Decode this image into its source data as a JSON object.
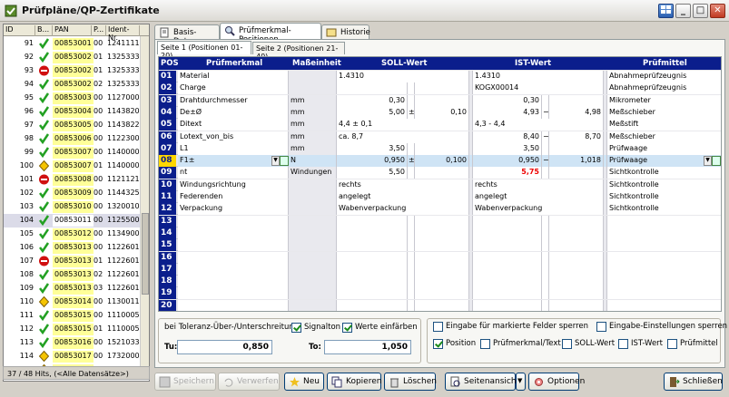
{
  "window": {
    "title": "Prüfpläne/QP-Zertifikate"
  },
  "left": {
    "columns": [
      "ID",
      "B...",
      "PAN",
      "P...",
      "Ident-Nr."
    ],
    "rows": [
      {
        "id": "91",
        "status": "ok",
        "pan": "00853001",
        "p": "00",
        "ident": "1241111"
      },
      {
        "id": "92",
        "status": "ok",
        "pan": "00853002",
        "p": "01",
        "ident": "1325333"
      },
      {
        "id": "93",
        "status": "stop",
        "pan": "00853002",
        "p": "01",
        "ident": "1325333"
      },
      {
        "id": "94",
        "status": "ok",
        "pan": "00853002",
        "p": "02",
        "ident": "1325333"
      },
      {
        "id": "95",
        "status": "ok",
        "pan": "00853003",
        "p": "00",
        "ident": "1127000"
      },
      {
        "id": "96",
        "status": "ok",
        "pan": "00853004",
        "p": "00",
        "ident": "1143820"
      },
      {
        "id": "97",
        "status": "ok",
        "pan": "00853005",
        "p": "00",
        "ident": "1143822"
      },
      {
        "id": "98",
        "status": "ok",
        "pan": "00853006",
        "p": "00",
        "ident": "1122300"
      },
      {
        "id": "99",
        "status": "ok",
        "pan": "00853007",
        "p": "00",
        "ident": "1140000"
      },
      {
        "id": "100",
        "status": "warn",
        "pan": "00853007",
        "p": "01",
        "ident": "1140000"
      },
      {
        "id": "101",
        "status": "stop",
        "pan": "00853008",
        "p": "00",
        "ident": "1121121"
      },
      {
        "id": "102",
        "status": "ok",
        "pan": "00853009",
        "p": "00",
        "ident": "1144325"
      },
      {
        "id": "103",
        "status": "ok",
        "pan": "00853010",
        "p": "00",
        "ident": "1320010"
      },
      {
        "id": "104",
        "status": "ok",
        "pan": "00853011",
        "p": "00",
        "ident": "1125500"
      },
      {
        "id": "105",
        "status": "ok",
        "pan": "00853012",
        "p": "00",
        "ident": "1134900"
      },
      {
        "id": "106",
        "status": "ok",
        "pan": "00853013",
        "p": "00",
        "ident": "1122601"
      },
      {
        "id": "107",
        "status": "stop",
        "pan": "00853013",
        "p": "01",
        "ident": "1122601"
      },
      {
        "id": "108",
        "status": "ok",
        "pan": "00853013",
        "p": "02",
        "ident": "1122601"
      },
      {
        "id": "109",
        "status": "ok",
        "pan": "00853013",
        "p": "03",
        "ident": "1122601"
      },
      {
        "id": "110",
        "status": "warn",
        "pan": "00853014",
        "p": "00",
        "ident": "1130011"
      },
      {
        "id": "111",
        "status": "ok",
        "pan": "00853015",
        "p": "00",
        "ident": "1110005"
      },
      {
        "id": "112",
        "status": "ok",
        "pan": "00853015",
        "p": "01",
        "ident": "1110005"
      },
      {
        "id": "113",
        "status": "ok",
        "pan": "00853016",
        "p": "00",
        "ident": "1521033"
      },
      {
        "id": "114",
        "status": "warn",
        "pan": "00853017",
        "p": "00",
        "ident": "1732000"
      },
      {
        "id": "115",
        "status": "warn",
        "pan": "00853018",
        "p": "00",
        "ident": "1630001"
      }
    ],
    "footer": "37 / 48 Hits, (<Alle Datensätze>)"
  },
  "tabs": [
    "Basis-Daten",
    "Prüfmerkmal-Positionen",
    "Historie"
  ],
  "subtabs": [
    "Seite 1 (Positionen 01-20)",
    "Seite 2 (Positionen 21-40)"
  ],
  "grid": {
    "headers": {
      "pos": "POS",
      "merkmal": "Prüfmerkmal",
      "einheit": "Maßeinheit",
      "soll": "SOLL-Wert",
      "ist": "IST-Wert",
      "mittel": "Prüfmittel"
    },
    "rows": [
      {
        "pos": "01",
        "merkmal": "Material",
        "einheit": "",
        "soll": "1.4310",
        "s1": "",
        "s2": "",
        "ist": "1.4310",
        "i1": "",
        "i2": "",
        "mittel": "Abnahmeprüfzeugnis"
      },
      {
        "pos": "02",
        "merkmal": "Charge",
        "einheit": "",
        "soll": "",
        "s1": "",
        "s2": "",
        "ist": "KOGX00014",
        "i1": "",
        "i2": "",
        "mittel": "Abnahmeprüfzeugnis"
      },
      {
        "pos": "03",
        "merkmal": "Drahtdurchmesser",
        "einheit": "mm",
        "soll": "",
        "s1": "0,30",
        "s2": "",
        "ist": "",
        "i1": "0,30",
        "i2": "",
        "mittel": "Mikrometer"
      },
      {
        "pos": "04",
        "merkmal": "De±Ø",
        "einheit": "mm",
        "soll": "",
        "s1": "5,00",
        "sop": "±",
        "s2": "0,10",
        "ist": "",
        "i1": "4,93",
        "iop": "−",
        "i2": "4,98",
        "mittel": "Meßschieber"
      },
      {
        "pos": "05",
        "merkmal": "Ditext",
        "einheit": "mm",
        "soll": "4,4 ± 0,1",
        "s1": "",
        "s2": "",
        "ist": "4,3 - 4,4",
        "i1": "",
        "i2": "",
        "mittel": "Meßstift"
      },
      {
        "pos": "06",
        "merkmal": "Lotext_von_bis",
        "einheit": "mm",
        "soll": "ca. 8,7",
        "s1": "",
        "s2": "",
        "ist": "",
        "i1": "8,40",
        "iop": "−",
        "i2": "8,70",
        "mittel": "Meßschieber"
      },
      {
        "pos": "07",
        "merkmal": "L1",
        "einheit": "mm",
        "soll": "",
        "s1": "3,50",
        "s2": "",
        "ist": "",
        "i1": "3,50",
        "i2": "",
        "mittel": "Prüfwaage"
      },
      {
        "pos": "08",
        "merkmal": "F1±",
        "einheit": "N",
        "soll": "",
        "s1": "0,950",
        "sop": "±",
        "s2": "0,100",
        "ist": "",
        "i1": "0,950",
        "iop": "−",
        "i2": "1,018",
        "mittel": "Prüfwaage"
      },
      {
        "pos": "09",
        "merkmal": "nt",
        "einheit": "Windungen",
        "soll": "",
        "s1": "5,50",
        "s2": "",
        "ist": "",
        "i1": "5,75",
        "i2": "",
        "mittel": "Sichtkontrolle"
      },
      {
        "pos": "10",
        "merkmal": "Windungsrichtung",
        "einheit": "",
        "soll": "rechts",
        "s1": "",
        "s2": "",
        "ist": "rechts",
        "i1": "",
        "i2": "",
        "mittel": "Sichtkontrolle"
      },
      {
        "pos": "11",
        "merkmal": "Federenden",
        "einheit": "",
        "soll": "angelegt",
        "s1": "",
        "s2": "",
        "ist": "angelegt",
        "i1": "",
        "i2": "",
        "mittel": "Sichtkontrolle"
      },
      {
        "pos": "12",
        "merkmal": "Verpackung",
        "einheit": "",
        "soll": "Wabenverpackung",
        "s1": "",
        "s2": "",
        "ist": "Wabenverpackung",
        "i1": "",
        "i2": "",
        "mittel": "Sichtkontrolle"
      },
      {
        "pos": "13",
        "merkmal": "",
        "einheit": "",
        "soll": "",
        "s1": "",
        "s2": "",
        "ist": "",
        "i1": "",
        "i2": "",
        "mittel": ""
      },
      {
        "pos": "14",
        "merkmal": "",
        "einheit": "",
        "soll": "",
        "s1": "",
        "s2": "",
        "ist": "",
        "i1": "",
        "i2": "",
        "mittel": ""
      },
      {
        "pos": "15",
        "merkmal": "",
        "einheit": "",
        "soll": "",
        "s1": "",
        "s2": "",
        "ist": "",
        "i1": "",
        "i2": "",
        "mittel": ""
      },
      {
        "pos": "16",
        "merkmal": "",
        "einheit": "",
        "soll": "",
        "s1": "",
        "s2": "",
        "ist": "",
        "i1": "",
        "i2": "",
        "mittel": ""
      },
      {
        "pos": "17",
        "merkmal": "",
        "einheit": "",
        "soll": "",
        "s1": "",
        "s2": "",
        "ist": "",
        "i1": "",
        "i2": "",
        "mittel": ""
      },
      {
        "pos": "18",
        "merkmal": "",
        "einheit": "",
        "soll": "",
        "s1": "",
        "s2": "",
        "ist": "",
        "i1": "",
        "i2": "",
        "mittel": ""
      },
      {
        "pos": "19",
        "merkmal": "",
        "einheit": "",
        "soll": "",
        "s1": "",
        "s2": "",
        "ist": "",
        "i1": "",
        "i2": "",
        "mittel": ""
      },
      {
        "pos": "20",
        "merkmal": "",
        "einheit": "",
        "soll": "",
        "s1": "",
        "s2": "",
        "ist": "",
        "i1": "",
        "i2": "",
        "mittel": ""
      }
    ]
  },
  "tolerance": {
    "label": "bei Toleranz-Über-/Unterschreitung:",
    "signal": "Signalton",
    "faerben": "Werte einfärben",
    "tu_label": "Tu:",
    "tu": "0,850",
    "to_label": "To:",
    "to": "1,050"
  },
  "sperren": {
    "eingabe": "Eingabe für markierte Felder sperren",
    "einst": "Eingabe-Einstellungen sperren",
    "position": "Position",
    "merkmal": "Prüfmerkmal/Text",
    "soll": "SOLL-Wert",
    "ist": "IST-Wert",
    "mittel": "Prüfmittel"
  },
  "buttons": {
    "speichern": "Speichern",
    "verwerfen": "Verwerfen",
    "neu": "Neu",
    "kopieren": "Kopieren",
    "loeschen": "Löschen",
    "seitenansicht": "Seitenansicht",
    "optionen": "Optionen",
    "schliessen": "Schließen"
  }
}
